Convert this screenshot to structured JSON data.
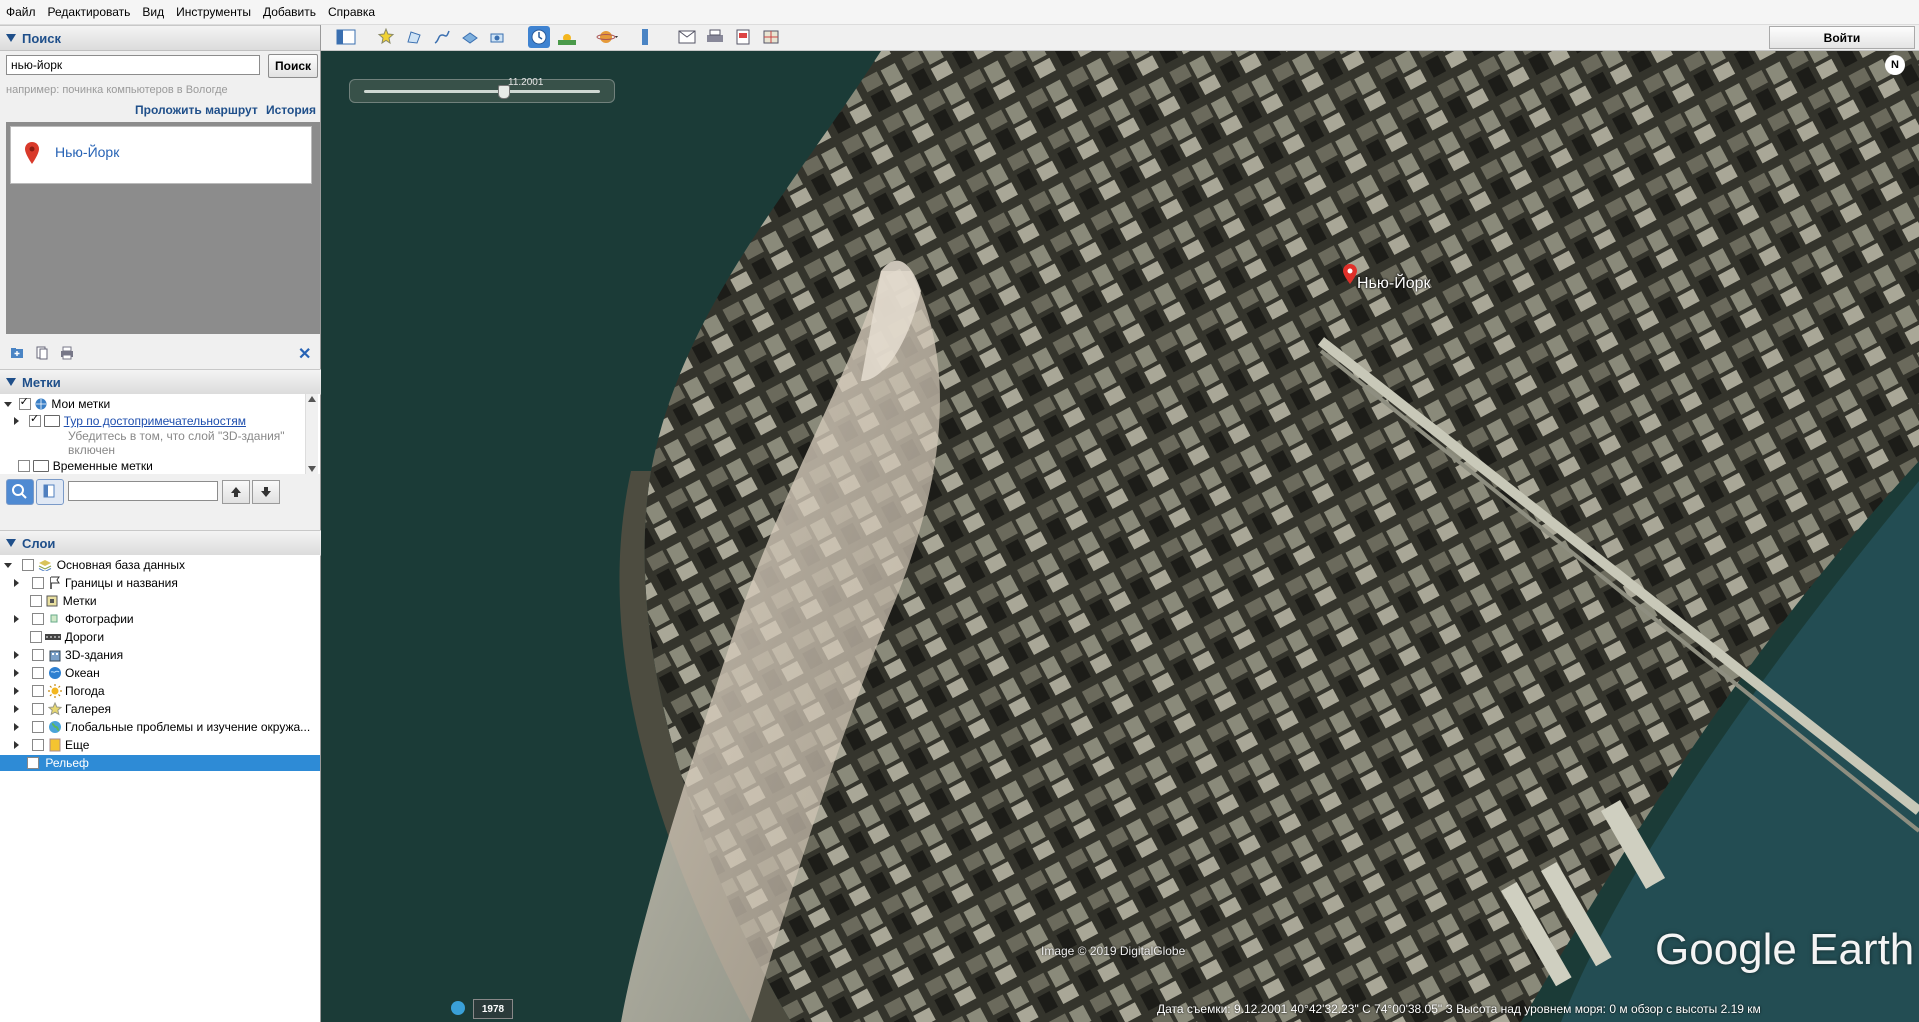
{
  "menu": [
    "Файл",
    "Редактировать",
    "Вид",
    "Инструменты",
    "Добавить",
    "Справка"
  ],
  "search": {
    "section_title": "Поиск",
    "query": "нью-йорк",
    "button": "Поиск",
    "hint": "например: починка компьютеров в Вологде",
    "route_link": "Проложить маршрут",
    "history_link": "История",
    "result": "Нью-Йорк"
  },
  "places": {
    "section_title": "Метки",
    "items": [
      {
        "label": "Мои метки",
        "checked": true
      },
      {
        "label": "Тур по достопримечательностям",
        "checked": true
      },
      {
        "label": "Убедитесь в том, что слой \"3D-здания\"",
        "checked": false
      },
      {
        "label": "включен",
        "checked": false
      },
      {
        "label": "Временные метки",
        "checked": false
      }
    ]
  },
  "layers": {
    "section_title": "Слои",
    "items": [
      {
        "label": "Основная база данных",
        "icon": "database-icon"
      },
      {
        "label": "Границы и названия",
        "icon": "borders-icon"
      },
      {
        "label": "Метки",
        "icon": "placemark-icon"
      },
      {
        "label": "Фотографии",
        "icon": "photos-icon"
      },
      {
        "label": "Дороги",
        "icon": "roads-icon"
      },
      {
        "label": "3D-здания",
        "icon": "buildings-3d-icon"
      },
      {
        "label": "Океан",
        "icon": "ocean-icon"
      },
      {
        "label": "Погода",
        "icon": "weather-icon"
      },
      {
        "label": "Галерея",
        "icon": "gallery-icon"
      },
      {
        "label": "Глобальные проблемы и изучение окружа...",
        "icon": "globe-icon"
      },
      {
        "label": "Еще",
        "icon": "more-icon"
      },
      {
        "label": "Рельеф",
        "icon": "terrain-icon"
      }
    ],
    "selected": "Рельеф"
  },
  "toolbar": {
    "login": "Войти"
  },
  "map": {
    "time_label": "11.2001",
    "place_label": "Нью-Йорк",
    "image_credit": "Image © 2019 DigitalGlobe",
    "logo": "Google Earth",
    "year": "1978",
    "north": "N",
    "status": "Дата съемки: 9.12.2001    40°42'32.23\" С    74°00'38.05\" З   Высота над уровнем моря:    0 м     обзор с высоты    2.19 км"
  },
  "colors": {
    "water": "#1a3a36",
    "city": "#3a3a30",
    "selected_row": "#2e8bd6",
    "link_blue": "#2763b5"
  }
}
